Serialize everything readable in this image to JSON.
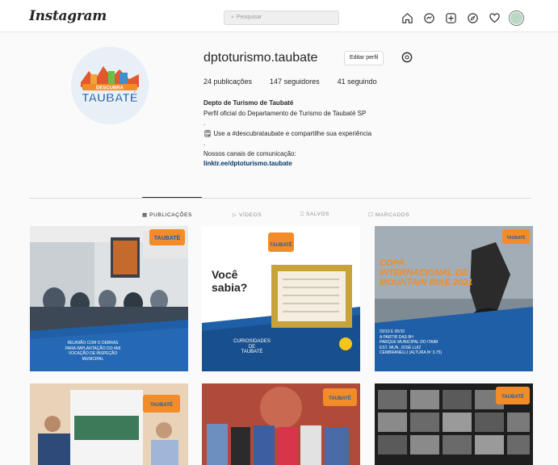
{
  "nav": {
    "logo": "Instagram",
    "search_placeholder": "Pesquisar",
    "icons": [
      "home-icon",
      "messenger-icon",
      "new-post-icon",
      "explore-icon",
      "activity-heart-icon",
      "profile-avatar"
    ]
  },
  "profile": {
    "username": "dptoturismo.taubate",
    "edit_label": "Editar perfil",
    "stats": {
      "posts": "24 publicações",
      "followers": "147 seguidores",
      "following": "41 seguindo"
    },
    "bio": {
      "name": "Depto de Turismo de Taubaté",
      "line1": "Perfil oficial do Departamento de Turismo de Taubaté SP",
      "line2": ".",
      "line3": "🗒 Use a #descubrataubate e compartilhe sua experiência",
      "line4": ".",
      "line5": "Nossos canais de comunicação:",
      "link": "linktr.ee/dptoturismo.taubate"
    },
    "logo_text_top": "DESCUBRA",
    "logo_text_main": "TAUBATÉ"
  },
  "tabs": [
    {
      "label": "PUBLICAÇÕES",
      "icon": "grid-icon"
    },
    {
      "label": "VÍDEOS",
      "icon": "video-icon"
    },
    {
      "label": "SALVOS",
      "icon": "bookmark-icon"
    },
    {
      "label": "MARCADOS",
      "icon": "tagged-icon"
    }
  ],
  "posts": {
    "p1_caption": "REUNIÃO COM O DEBRAS\nPARA IMPLANTAÇÃO DO 4MI\nVOCAÇÃO DE INSPEÇÃO\nMUNICIPAL",
    "p2_title": "Você\nsabia?",
    "p2_caption": "CURIOSIDADES\nDE\nTAUBATÉ",
    "p3_title": "COPA INTERNACIONAL DE MOUNTAIN BIKE 2021",
    "p3_caption": "03/10 E 05/10\nA PARTIR DAS 8H\nPARQUE MUNICIPAL DO ITAIM\nEST. MUN. JOSÉ LUIZ\nCEMBRANELLI (ALTURA Nº 3.75)"
  }
}
